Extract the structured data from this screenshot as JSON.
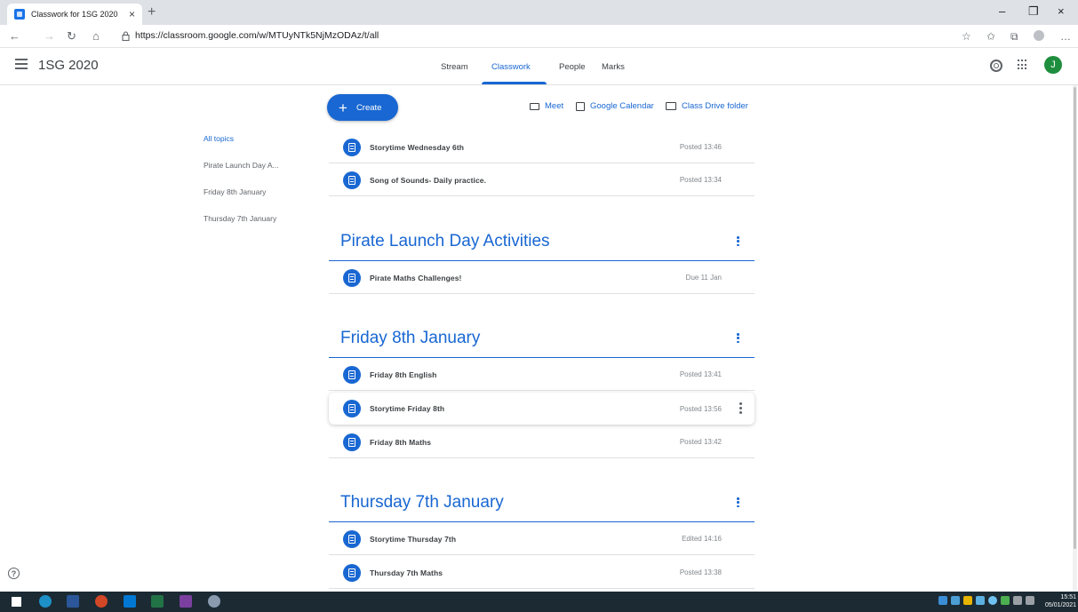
{
  "browser": {
    "tab_title": "Classwork for 1SG 2020",
    "tab_close": "×",
    "new_tab": "+",
    "url": "https://classroom.google.com/w/MTUyNTk5NjMzODAz/t/all",
    "nav": {
      "back": "←",
      "forward": "→",
      "refresh": "↻",
      "home": "⌂"
    },
    "window": {
      "minimize": "–",
      "maximize": "❐",
      "close": "×"
    },
    "toolbar": {
      "favorites": "☆",
      "collections": "✩",
      "tabs": "⧉",
      "more": "…"
    }
  },
  "header": {
    "class_name": "1SG 2020",
    "tabs": [
      {
        "label": "Stream"
      },
      {
        "label": "Classwork"
      },
      {
        "label": "People"
      },
      {
        "label": "Marks"
      }
    ],
    "active_tab": "Classwork",
    "avatar_initial": "J"
  },
  "toolbar": {
    "create_label": "Create",
    "links": [
      {
        "label": "Meet",
        "icon": "video-icon"
      },
      {
        "label": "Google Calendar",
        "icon": "calendar-icon"
      },
      {
        "label": "Class Drive folder",
        "icon": "folder-icon"
      }
    ]
  },
  "topic_nav": [
    {
      "label": "All topics",
      "active": true
    },
    {
      "label": "Pirate Launch Day A..."
    },
    {
      "label": "Friday 8th January"
    },
    {
      "label": "Thursday 7th January"
    }
  ],
  "no_topic_items": [
    {
      "title": "Storytime Wednesday 6th",
      "meta": "Posted 13:46",
      "icon": "assignment-icon"
    },
    {
      "title": "Song of Sounds- Daily practice.",
      "meta": "Posted 13:34",
      "icon": "material-icon"
    }
  ],
  "topics": [
    {
      "title": "Pirate Launch Day Activities",
      "items": [
        {
          "title": "Pirate Maths Challenges!",
          "meta": "Due 11 Jan"
        }
      ]
    },
    {
      "title": "Friday 8th January",
      "items": [
        {
          "title": "Friday 8th English",
          "meta": "Posted 13:41"
        },
        {
          "title": "Storytime Friday 8th",
          "meta": "Posted 13:56",
          "hovered": true
        },
        {
          "title": "Friday 8th Maths",
          "meta": "Posted 13:42"
        }
      ]
    },
    {
      "title": "Thursday 7th January",
      "items": [
        {
          "title": "Storytime Thursday 7th",
          "meta": "Edited 14:16"
        },
        {
          "title": "Thursday 7th Maths",
          "meta": "Posted 13:38"
        }
      ]
    }
  ],
  "help_glyph": "?",
  "taskbar": {
    "time": "15:51",
    "date": "05/01/2021"
  },
  "colors": {
    "accent": "#1967d2",
    "avatar": "#1e8e3e",
    "taskbar": "#1b2a33"
  }
}
